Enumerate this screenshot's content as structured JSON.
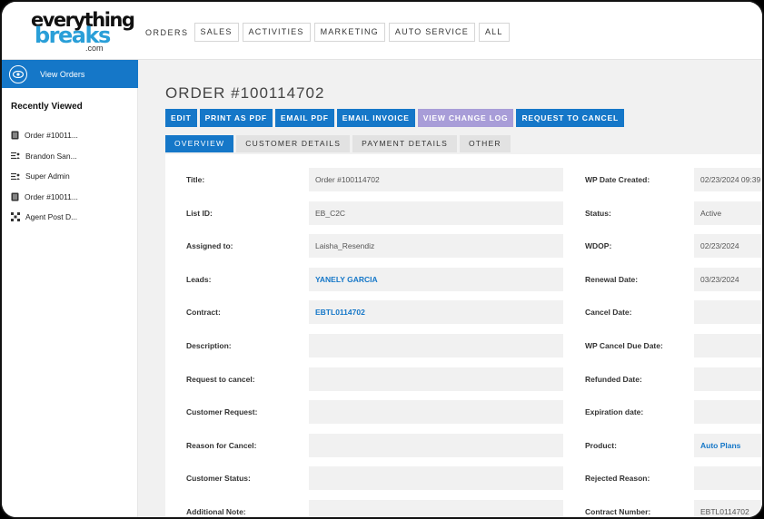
{
  "logo": {
    "line1": "everything",
    "line2": "breaks",
    "line3": ".com"
  },
  "nav": {
    "lead": "ORDERS",
    "items": [
      "SALES",
      "ACTIVITIES",
      "MARKETING",
      "AUTO SERVICE",
      "ALL"
    ]
  },
  "sidebar": {
    "view_orders": "View Orders",
    "collapse_icon": "chevron-left-icon",
    "recently_viewed_title": "Recently Viewed",
    "recent": [
      {
        "label": "Order #10011...",
        "icon": "document-icon"
      },
      {
        "label": "Brandon San...",
        "icon": "user-list-icon"
      },
      {
        "label": "Super Admin",
        "icon": "user-list-icon"
      },
      {
        "label": "Order #10011...",
        "icon": "document-icon"
      },
      {
        "label": "Agent Post D...",
        "icon": "grid-icon"
      }
    ]
  },
  "order": {
    "title": "ORDER #100114702",
    "actions": [
      "EDIT",
      "PRINT AS PDF",
      "EMAIL PDF",
      "EMAIL INVOICE",
      "VIEW CHANGE LOG",
      "REQUEST TO CANCEL"
    ],
    "tabs": [
      "OVERVIEW",
      "CUSTOMER DETAILS",
      "PAYMENT DETAILS",
      "OTHER"
    ]
  },
  "fields_left": [
    {
      "label": "Title:",
      "value": "Order #100114702"
    },
    {
      "label": "List ID:",
      "value": "EB_C2C"
    },
    {
      "label": "Assigned to:",
      "value": "Laisha_Resendiz"
    },
    {
      "label": "Leads:",
      "value": "YANELY GARCIA"
    },
    {
      "label": "Contract:",
      "value": "EBTL0114702"
    },
    {
      "label": "Description:",
      "value": ""
    },
    {
      "label": "Request to cancel:",
      "value": ""
    },
    {
      "label": "Customer Request:",
      "value": ""
    },
    {
      "label": "Reason for Cancel:",
      "value": ""
    },
    {
      "label": "Customer Status:",
      "value": ""
    },
    {
      "label": "Additional Note:",
      "value": ""
    }
  ],
  "fields_right": [
    {
      "label": "WP Date Created:",
      "value": "02/23/2024 09:39"
    },
    {
      "label": "Status:",
      "value": "Active"
    },
    {
      "label": "WDOP:",
      "value": "02/23/2024"
    },
    {
      "label": "Renewal Date:",
      "value": "03/23/2024"
    },
    {
      "label": "Cancel Date:",
      "value": ""
    },
    {
      "label": "WP Cancel Due Date:",
      "value": ""
    },
    {
      "label": "Refunded Date:",
      "value": ""
    },
    {
      "label": "Expiration date:",
      "value": ""
    },
    {
      "label": "Product:",
      "value": "Auto Plans"
    },
    {
      "label": "Rejected Reason:",
      "value": ""
    },
    {
      "label": "Contract Number:",
      "value": "EBTL0114702"
    }
  ],
  "colors": {
    "primary": "#1577c8",
    "muted_button": "#a89dd8",
    "logo_blue": "#2a9fd8"
  }
}
